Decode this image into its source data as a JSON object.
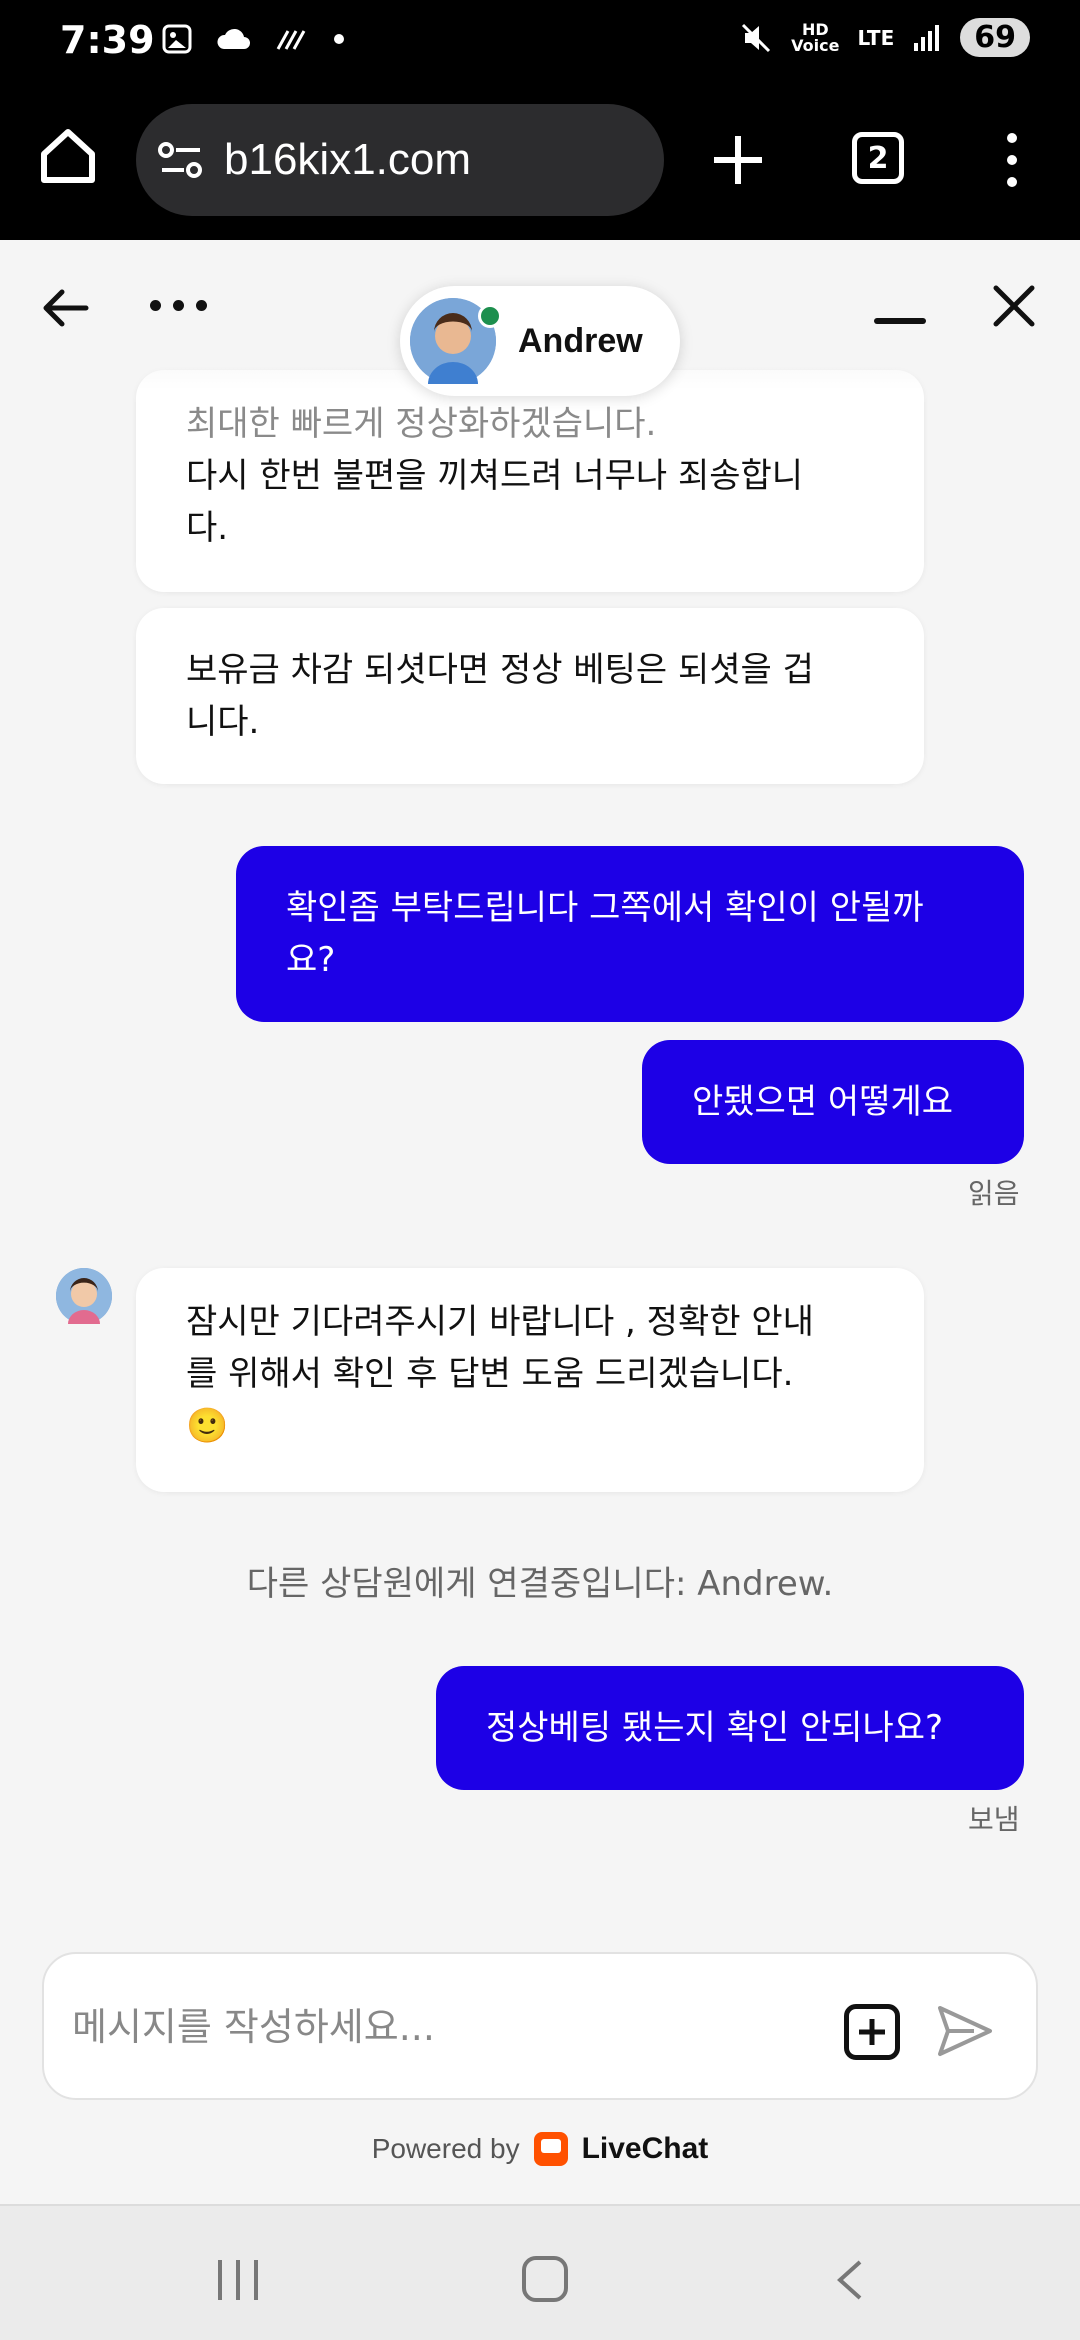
{
  "status_bar": {
    "time": "7:39",
    "battery": "69",
    "network": "LTE",
    "hd_voice_top": "HD",
    "hd_voice_bottom": "Voice"
  },
  "browser": {
    "url": "b16kix1.com",
    "tab_count": "2"
  },
  "chat": {
    "agent_name": "Andrew",
    "messages": [
      {
        "from": "agent",
        "lines": [
          "최대한 빠르게 정상화하겠습니다.",
          "다시 한번 불편을 끼쳐드려 너무나 죄송합니",
          "다."
        ]
      },
      {
        "from": "agent",
        "lines": [
          "보유금 차감 되셧다면 정상 베팅은 되셧을 겁",
          "니다."
        ]
      },
      {
        "from": "user",
        "lines": [
          "확인좀 부탁드립니다 그쪽에서 확인이 안될까",
          "요?"
        ]
      },
      {
        "from": "user",
        "lines": [
          "안됐으면 어떻게요"
        ],
        "receipt": "읽음"
      },
      {
        "from": "agent",
        "lines": [
          "잠시만 기다려주시기 바랍니다 , 정확한 안내",
          "를 위해서 확인 후 답변 도움 드리겠습니다.",
          "🙂"
        ]
      },
      {
        "from": "system",
        "text": "다른 상담원에게 연결중입니다: Andrew."
      },
      {
        "from": "user",
        "lines": [
          "정상베팅 됐는지 확인 안되나요?"
        ],
        "receipt": "보냄"
      }
    ]
  },
  "composer": {
    "placeholder": "메시지를 작성하세요..."
  },
  "footer": {
    "powered_by": "Powered by",
    "brand": "LiveChat"
  },
  "colors": {
    "user_bubble": "#1d00e6",
    "online": "#1d8f4e",
    "livechat": "#ff5100"
  }
}
